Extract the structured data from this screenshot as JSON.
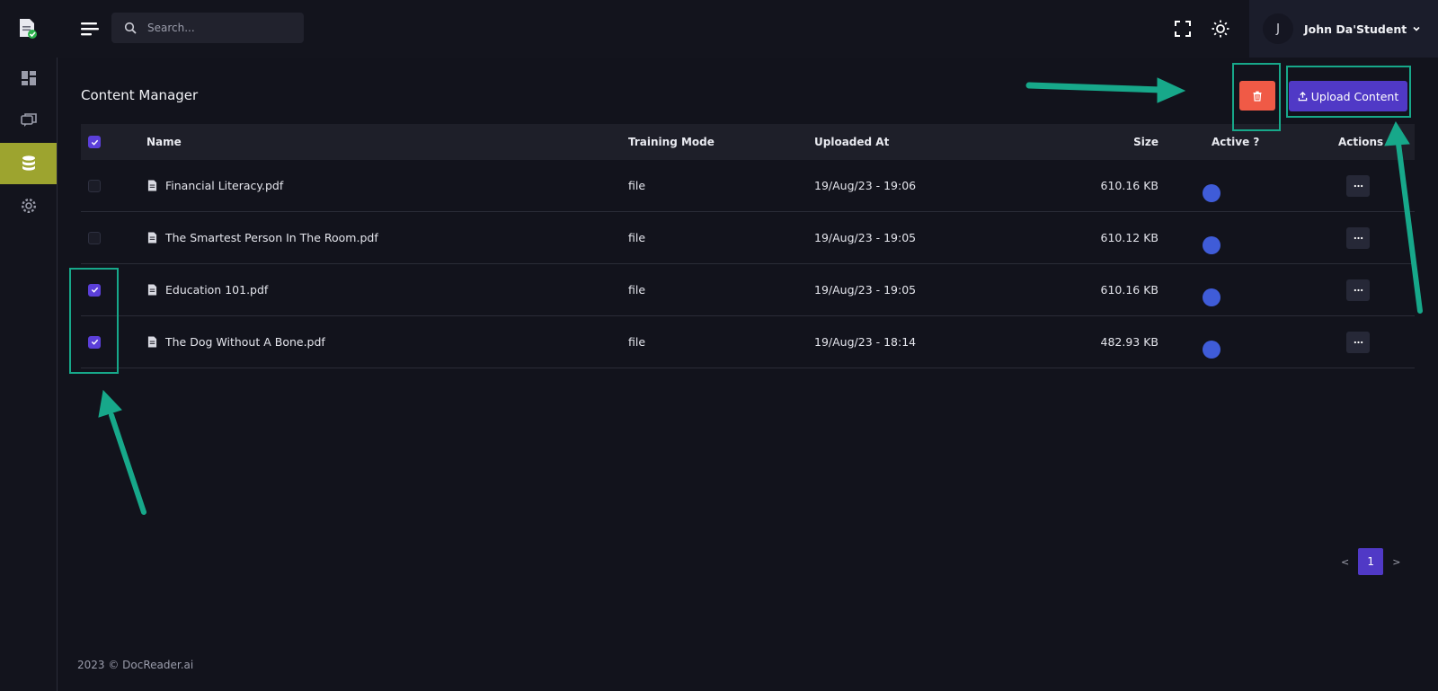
{
  "search": {
    "placeholder": "Search..."
  },
  "user": {
    "initial": "J",
    "name": "John Da'Student"
  },
  "page": {
    "title": "Content Manager"
  },
  "upload": {
    "label": "Upload Content"
  },
  "table": {
    "headers": {
      "name": "Name",
      "mode": "Training Mode",
      "uploaded": "Uploaded At",
      "size": "Size",
      "active": "Active ?",
      "actions": "Actions"
    },
    "rows": [
      {
        "name": "Financial Literacy.pdf",
        "mode": "file",
        "uploaded": "19/Aug/23 - 19:06",
        "size": "610.16 KB",
        "active": true,
        "checked": false
      },
      {
        "name": "The Smartest Person In The Room.pdf",
        "mode": "file",
        "uploaded": "19/Aug/23 - 19:05",
        "size": "610.12 KB",
        "active": true,
        "checked": false
      },
      {
        "name": "Education 101.pdf",
        "mode": "file",
        "uploaded": "19/Aug/23 - 19:05",
        "size": "610.16 KB",
        "active": true,
        "checked": true
      },
      {
        "name": "The Dog Without A Bone.pdf",
        "mode": "file",
        "uploaded": "19/Aug/23 - 18:14",
        "size": "482.93 KB",
        "active": true,
        "checked": true
      }
    ]
  },
  "pagination": {
    "prev": "<",
    "current": "1",
    "next": ">"
  },
  "footer": {
    "text": "2023 © DocReader.ai"
  },
  "colors": {
    "accent": "#5039c6",
    "danger": "#f05a46",
    "sidebar_active": "#9da42f",
    "annotation": "#17a88a"
  }
}
